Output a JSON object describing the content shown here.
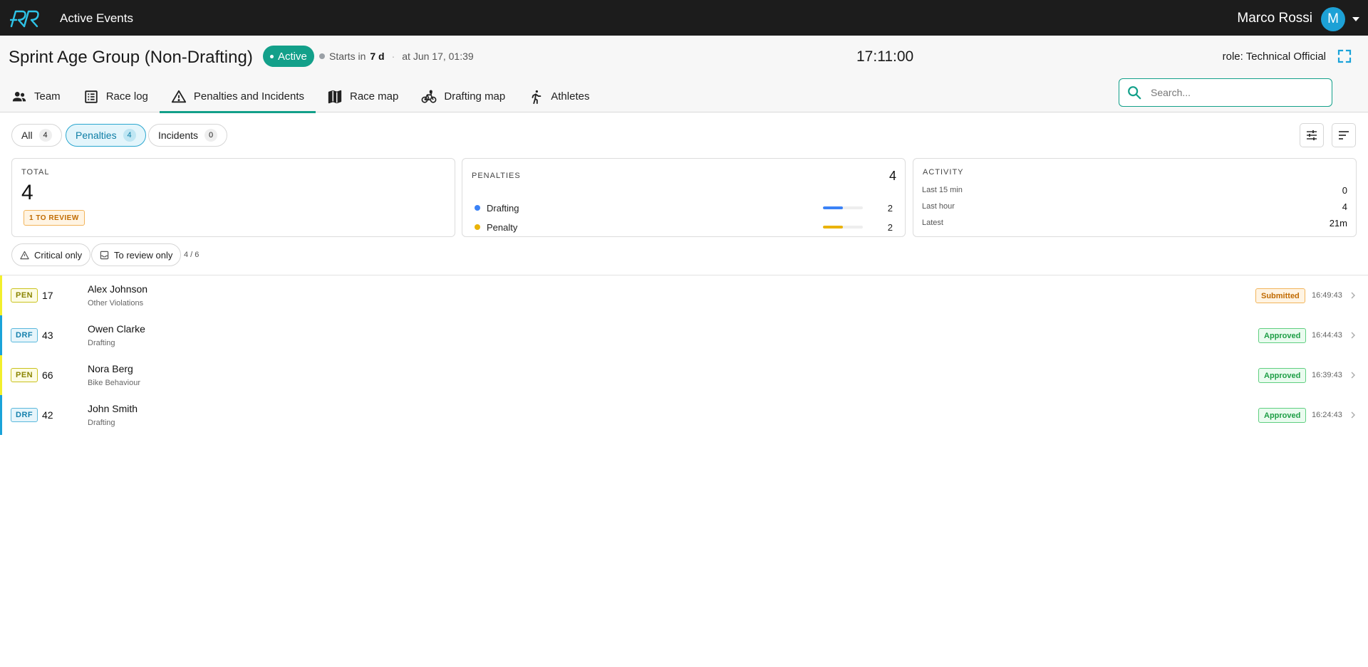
{
  "app": {
    "title": "Active Events",
    "user_name": "Marco Rossi",
    "avatar_initial": "M"
  },
  "event": {
    "title": "Sprint Age Group (Non-Drafting)",
    "status": "Active",
    "starts_prefix": "Starts in",
    "starts_in": "7 d",
    "starts_at": "at Jun 17, 01:39",
    "clock": "17:11:00",
    "role": "role: Technical Official"
  },
  "tabs": [
    {
      "label": "Team",
      "icon": "team-icon"
    },
    {
      "label": "Race log",
      "icon": "race-log-icon"
    },
    {
      "label": "Penalties and Incidents",
      "icon": "warning-icon",
      "active": true
    },
    {
      "label": "Race map",
      "icon": "map-icon"
    },
    {
      "label": "Drafting map",
      "icon": "bicycle-icon"
    },
    {
      "label": "Athletes",
      "icon": "runner-icon"
    }
  ],
  "search": {
    "placeholder": "Search..."
  },
  "filters": [
    {
      "label": "All",
      "count": "4"
    },
    {
      "label": "Penalties",
      "count": "4",
      "active": true
    },
    {
      "label": "Incidents",
      "count": "0"
    }
  ],
  "stats": {
    "total": {
      "label": "TOTAL",
      "value": "4",
      "review_badge": "1 TO REVIEW"
    },
    "penalties": {
      "label": "PENALTIES",
      "total": "4",
      "items": [
        {
          "label": "Drafting",
          "value": "2",
          "fraction": 0.5,
          "color": "#3b82f6"
        },
        {
          "label": "Penalty",
          "value": "2",
          "fraction": 0.5,
          "color": "#eab308"
        }
      ]
    },
    "activity": {
      "label": "ACTIVITY",
      "items": [
        {
          "label": "Last 15 min",
          "value": "0"
        },
        {
          "label": "Last hour",
          "value": "4"
        },
        {
          "label": "Latest",
          "value": "21m"
        }
      ]
    }
  },
  "quick_filters": {
    "critical": "Critical only",
    "review": "To review only",
    "count": "4 / 6"
  },
  "colors": {
    "accent": "#13a08a",
    "pen": "#f2ef2c",
    "drf": "#1aa3d9",
    "submitted": "#f0a030",
    "approved": "#22b24c"
  },
  "records": [
    {
      "code": "PEN",
      "number": "17",
      "name": "Alex Johnson",
      "category": "Other Violations",
      "status": "Submitted",
      "time": "16:49:43"
    },
    {
      "code": "DRF",
      "number": "43",
      "name": "Owen Clarke",
      "category": "Drafting",
      "status": "Approved",
      "time": "16:44:43"
    },
    {
      "code": "PEN",
      "number": "66",
      "name": "Nora Berg",
      "category": "Bike Behaviour",
      "status": "Approved",
      "time": "16:39:43"
    },
    {
      "code": "DRF",
      "number": "42",
      "name": "John Smith",
      "category": "Drafting",
      "status": "Approved",
      "time": "16:24:43"
    }
  ]
}
